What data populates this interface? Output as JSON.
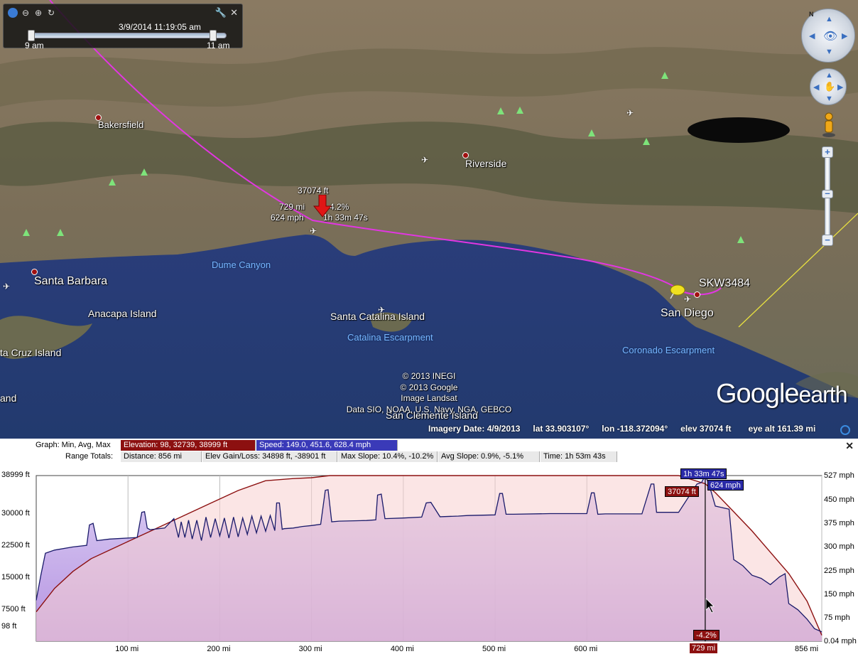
{
  "timeslider": {
    "datetime": "3/9/2014  11:19:05 am",
    "start_label": "9 am",
    "end_label": "11 am"
  },
  "map": {
    "cities": [
      {
        "name": "Bakersfield"
      },
      {
        "name": "Riverside"
      },
      {
        "name": "Santa Barbara"
      },
      {
        "name": "San Diego"
      }
    ],
    "water_labels": [
      "Dume Canyon",
      "Catalina Escarpment",
      "Coronado Escarpment"
    ],
    "islands": [
      "Anacapa Island",
      "Santa Catalina Island",
      "ta Cruz Island",
      "and",
      "San Clemente Island"
    ],
    "flight_label": "SKW3484",
    "marker": {
      "altitude": "37074 ft",
      "distance": "729 mi",
      "slope": "-4.2%",
      "speed": "624 mph",
      "elapsed": "1h 33m 47s"
    },
    "copyright": [
      "© 2013 INEGI",
      "© 2013 Google",
      "Image Landsat",
      "Data SIO, NOAA, U.S. Navy, NGA, GEBCO"
    ],
    "logo_main": "Google",
    "logo_sub": "earth"
  },
  "status": {
    "imagery_date": "Imagery Date: 4/9/2013",
    "lat": "lat   33.903107°",
    "lon": "lon  -118.372094°",
    "elev": "elev  37074 ft",
    "eye_alt": "eye alt  161.39 mi"
  },
  "profile": {
    "graph_label": "Graph: Min, Avg, Max",
    "range_label": "Range Totals:",
    "elevation_stat": "Elevation: 98, 32739, 38999 ft",
    "speed_stat": "Speed: 149.0, 451.6, 628.4 mph",
    "distance_stat": "Distance: 856 mi",
    "gain_loss_stat": "Elev Gain/Loss: 34898 ft, -38901 ft",
    "max_slope_stat": "Max Slope: 10.4%, -10.2%",
    "avg_slope_stat": "Avg Slope: 0.9%, -5.1%",
    "time_stat": "Time: 1h 53m 43s",
    "cursor": {
      "time": "1h 33m 47s",
      "elevation": "37074 ft",
      "speed": "624 mph",
      "slope": "-4.2%",
      "distance": "729 mi"
    }
  },
  "chart_data": {
    "type": "area",
    "x_unit": "mi",
    "xlim": [
      0,
      856
    ],
    "x_ticks": [
      "100 mi",
      "200 mi",
      "300 mi",
      "400 mi",
      "500 mi",
      "600 mi",
      "729 mi",
      "856 mi"
    ],
    "y_left_ticks": [
      "38999 ft",
      "30000 ft",
      "22500 ft",
      "15000 ft",
      "7500 ft",
      "98 ft"
    ],
    "y_right_ticks": [
      "527 mph",
      "450 mph",
      "375 mph",
      "300 mph",
      "225 mph",
      "150 mph",
      "75 mph",
      "0.04 mph"
    ],
    "ylim_left": [
      98,
      38999
    ],
    "ylim_right": [
      0.04,
      527
    ],
    "series": [
      {
        "name": "Elevation",
        "color": "#8c1010",
        "x": [
          0,
          20,
          40,
          60,
          80,
          100,
          130,
          160,
          190,
          220,
          250,
          280,
          300,
          320,
          340,
          360,
          380,
          400,
          500,
          600,
          700,
          729,
          740,
          760,
          780,
          800,
          820,
          840,
          856
        ],
        "y": [
          7000,
          12500,
          16500,
          19500,
          21500,
          23500,
          26500,
          29500,
          32500,
          35500,
          37800,
          38300,
          38500,
          38999,
          38999,
          38999,
          38999,
          38999,
          38999,
          38999,
          38999,
          37074,
          35000,
          30500,
          26000,
          21000,
          16000,
          9500,
          1500
        ]
      },
      {
        "name": "Speed",
        "color": "#20206a",
        "x": [
          0,
          5,
          10,
          20,
          40,
          55,
          58,
          62,
          66,
          80,
          110,
          115,
          118,
          121,
          124,
          140,
          150,
          155,
          158,
          162,
          166,
          170,
          175,
          180,
          185,
          190,
          195,
          200,
          205,
          210,
          215,
          220,
          225,
          230,
          235,
          240,
          245,
          250,
          255,
          260,
          262,
          265,
          268,
          270,
          280,
          290,
          300,
          310,
          315,
          318,
          322,
          330,
          360,
          370,
          372,
          376,
          380,
          400,
          420,
          425,
          430,
          440,
          460,
          470,
          500,
          505,
          508,
          512,
          520,
          560,
          600,
          605,
          608,
          612,
          620,
          660,
          670,
          673,
          676,
          680,
          700,
          720,
          725,
          729,
          733,
          740,
          755,
          760,
          770,
          780,
          790,
          800,
          810,
          816,
          820,
          830,
          840,
          848,
          856
        ],
        "y": [
          130,
          210,
          280,
          290,
          300,
          305,
          370,
          375,
          320,
          325,
          330,
          410,
          412,
          360,
          355,
          360,
          390,
          330,
          380,
          330,
          385,
          325,
          385,
          320,
          395,
          330,
          390,
          335,
          392,
          328,
          395,
          332,
          392,
          340,
          398,
          345,
          398,
          350,
          400,
          352,
          440,
          440,
          356,
          358,
          360,
          365,
          368,
          372,
          480,
          482,
          380,
          382,
          384,
          386,
          465,
          468,
          390,
          392,
          395,
          440,
          442,
          396,
          398,
          400,
          402,
          470,
          470,
          404,
          404,
          406,
          406,
          472,
          472,
          404,
          405,
          405,
          500,
          500,
          410,
          410,
          410,
          500,
          505,
          624,
          500,
          430,
          420,
          260,
          240,
          210,
          200,
          180,
          205,
          215,
          120,
          100,
          70,
          40,
          30
        ]
      }
    ],
    "cursor_x": 729
  }
}
